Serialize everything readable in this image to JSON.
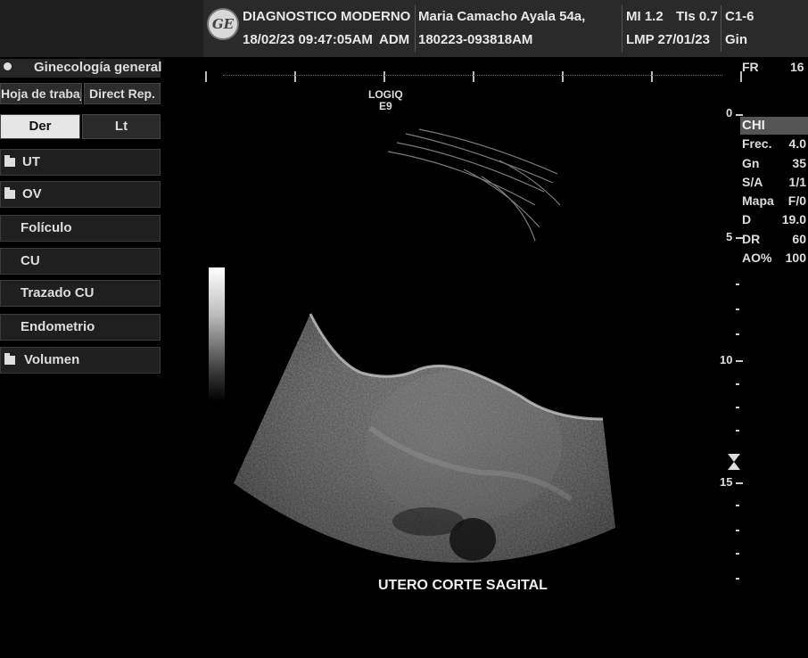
{
  "header": {
    "logo_text": "GE",
    "institution": "DIAGNOSTICO MODERNO",
    "datetime": "18/02/23 09:47:05AM",
    "operator": "ADM",
    "patient": "Maria Camacho Ayala 54a,",
    "exam_id": "180223-093818AM",
    "mi": "MI 1.2",
    "tis": "TIs 0.7",
    "lmp": "LMP 27/01/23",
    "probe": "C1-6",
    "preset": "Gin"
  },
  "left_panel": {
    "title": "Ginecología general",
    "tabs": [
      "Hoja de trabajo",
      "Direct Rep."
    ],
    "sides": [
      "Der",
      "Lt"
    ],
    "items": [
      {
        "label": "UT",
        "folder": true
      },
      {
        "label": "OV",
        "folder": true
      },
      {
        "label": "Folículo",
        "folder": false
      },
      {
        "label": "CU",
        "folder": false
      },
      {
        "label": "Trazado CU",
        "folder": false
      },
      {
        "label": "Endometrio",
        "folder": false
      },
      {
        "label": "Volumen",
        "folder": true
      }
    ]
  },
  "image": {
    "system": "LOGIQ",
    "model": "E9",
    "caption": "UTERO CORTE SAGITAL",
    "depth_labels": [
      "0",
      "5",
      "10",
      "15"
    ]
  },
  "right_panel": {
    "fr_label": "FR",
    "fr_value": "16",
    "mode": "CHI",
    "params": [
      {
        "key": "Frec.",
        "value": "4.0"
      },
      {
        "key": "Gn",
        "value": "35"
      },
      {
        "key": "S/A",
        "value": "1/1"
      },
      {
        "key": "Mapa",
        "value": "F/0"
      },
      {
        "key": "D",
        "value": "19.0"
      },
      {
        "key": "DR",
        "value": "60"
      },
      {
        "key": "AO%",
        "value": "100"
      }
    ]
  }
}
